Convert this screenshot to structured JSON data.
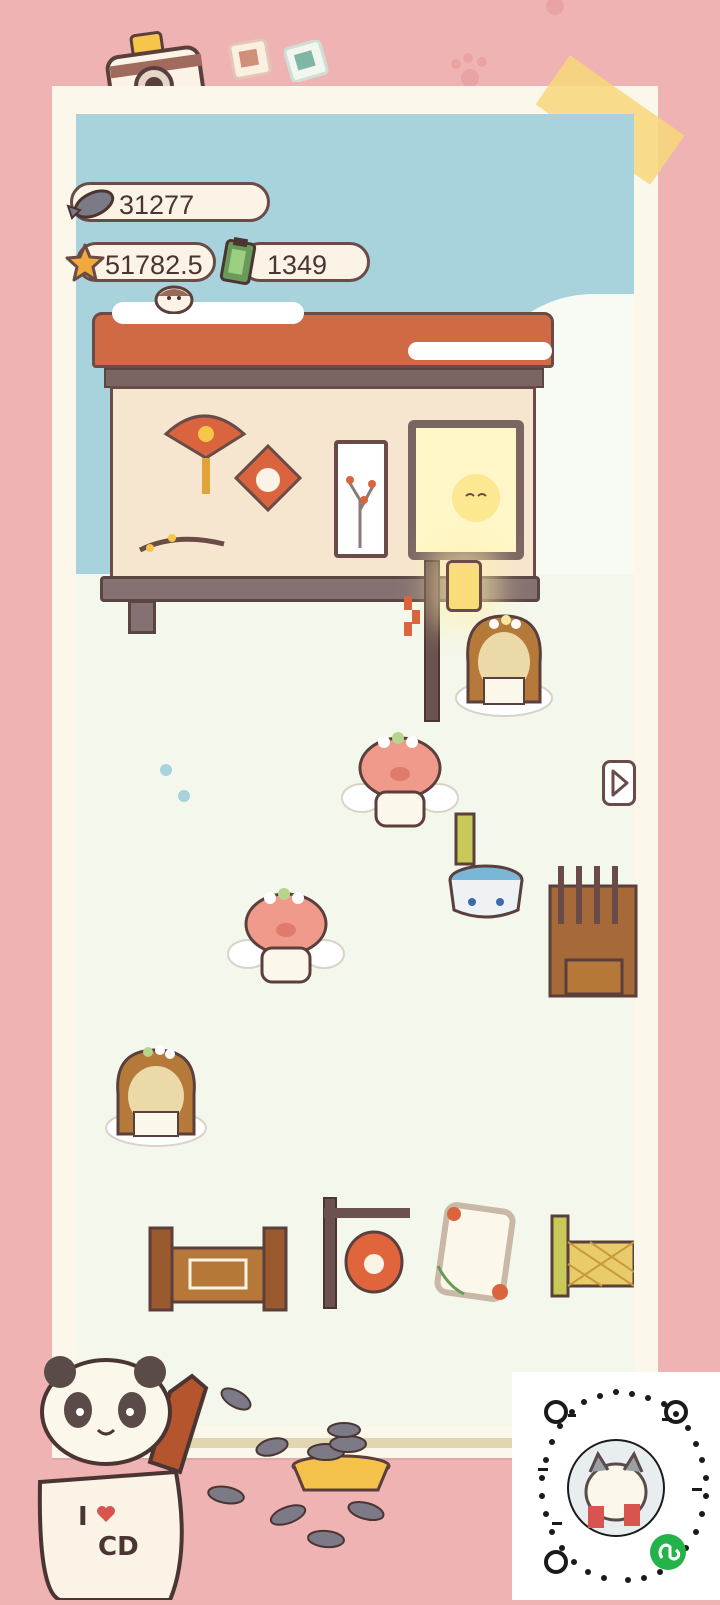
{
  "hud": {
    "fish_count": "31277",
    "star_count": "51782.5",
    "battery_count": "1349"
  },
  "mascot": {
    "shirt_line1": "I",
    "shirt_line2": "CD"
  },
  "colors": {
    "background_pink": "#f0b3b3",
    "frame_cream": "#fbf7ea",
    "sky_blue": "#a8d3dd",
    "roof_orange": "#cf6a45",
    "outline_brown": "#6b4b47",
    "wechat_green": "#24b34b"
  },
  "icons": [
    "camera-icon",
    "photo-thumb-icon",
    "fish-icon",
    "star-icon",
    "battery-icon",
    "next-arrow-icon",
    "mini-program-icon"
  ]
}
